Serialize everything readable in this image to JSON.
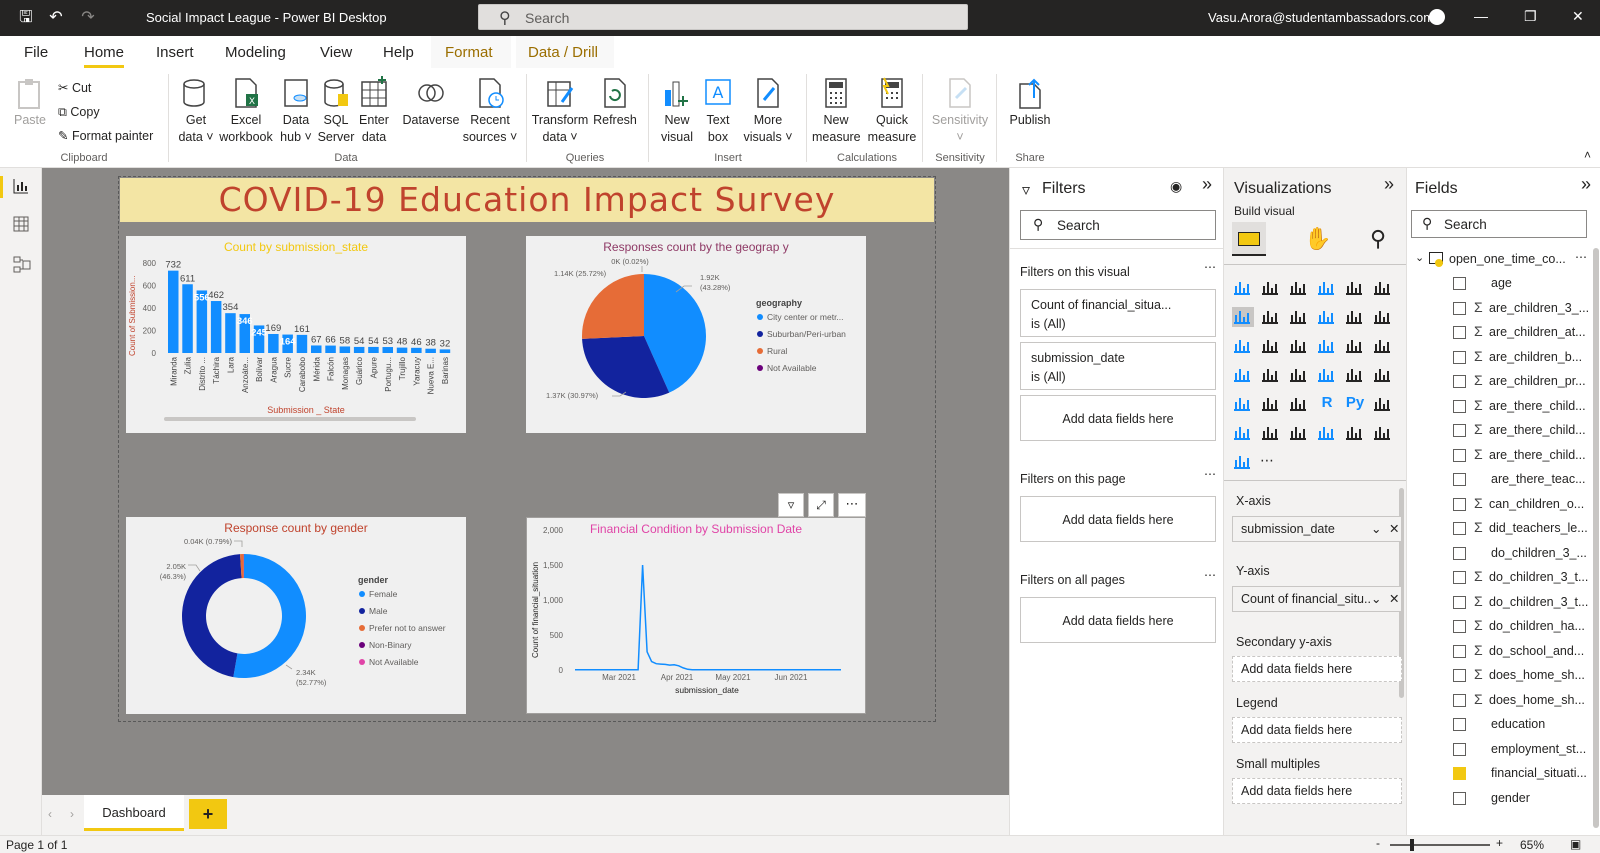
{
  "app": {
    "title": "Social Impact League - Power BI Desktop",
    "search_placeholder": "Search",
    "user": "Vasu.Arora@studentambassadors.com"
  },
  "menu": [
    "File",
    "Home",
    "Insert",
    "Modeling",
    "View",
    "Help",
    "Format",
    "Data / Drill"
  ],
  "ribbon": {
    "paste": "Paste",
    "cut": "Cut",
    "copy": "Copy",
    "format_painter": "Format painter",
    "clipboard": "Clipboard",
    "get_data": [
      "Get",
      "data"
    ],
    "excel": [
      "Excel",
      "workbook"
    ],
    "data_hub": [
      "Data",
      "hub"
    ],
    "sql": [
      "SQL",
      "Server"
    ],
    "enter_data": [
      "Enter",
      "data"
    ],
    "dataverse": "Dataverse",
    "recent": [
      "Recent",
      "sources"
    ],
    "data_group": "Data",
    "transform": [
      "Transform",
      "data"
    ],
    "refresh": "Refresh",
    "queries": "Queries",
    "new_visual": [
      "New",
      "visual"
    ],
    "text_box": [
      "Text",
      "box"
    ],
    "more_visuals": [
      "More",
      "visuals"
    ],
    "insert": "Insert",
    "new_measure": [
      "New",
      "measure"
    ],
    "quick_measure": [
      "Quick",
      "measure"
    ],
    "calculations": "Calculations",
    "sensitivity_btn": "Sensitivity",
    "sensitivity": "Sensitivity",
    "publish": "Publish",
    "share": "Share"
  },
  "report": {
    "title": "COVID-19 Education Impact Survey",
    "tab": "Dashboard",
    "page_status": "Page 1 of 1",
    "zoom": "65%"
  },
  "chart_data": [
    {
      "type": "bar",
      "title": "Count by submission_state",
      "xlabel": "Submission _ State",
      "ylabel": "Count of Submission...",
      "ylim": [
        0,
        800
      ],
      "yticks": [
        "800",
        "600",
        "400",
        "200",
        "0"
      ],
      "categories": [
        "Miranda",
        "Zulia",
        "Distrito ...",
        "Táchira",
        "Lara",
        "Anzoáte...",
        "Bolívar",
        "Aragua",
        "Sucre",
        "Carabobo",
        "Mérida",
        "Falcón",
        "Monagas",
        "Guárico",
        "Apure",
        "Portugu...",
        "Trujillo",
        "Yaracuy",
        "Nueva E...",
        "Barinas"
      ],
      "values": [
        732,
        611,
        556,
        462,
        354,
        346,
        245,
        169,
        164,
        161,
        67,
        66,
        58,
        54,
        54,
        53,
        48,
        46,
        38,
        32
      ],
      "labels": [
        "732",
        "611",
        "556",
        "462",
        "354",
        "346",
        "245",
        "169",
        "164",
        "161",
        "67",
        "66",
        "58",
        "54",
        "54",
        "53",
        "48",
        "46",
        "38",
        "32"
      ]
    },
    {
      "type": "pie",
      "title": "Responses count by the geograp y",
      "legend_title": "geography",
      "slices": [
        {
          "name": "City center or metr...",
          "value": 1920,
          "label": "1.92K\n(43.28%)",
          "color": "#118dff"
        },
        {
          "name": "Suburban/Peri-urban",
          "value": 1370,
          "label": "1.37K (30.97%)",
          "color": "#12239e"
        },
        {
          "name": "Rural",
          "value": 1140,
          "label": "1.14K (25.72%)",
          "color": "#e66c37"
        },
        {
          "name": "Not Available",
          "value": 1,
          "label": "0K (0.02%)",
          "color": "#6b007b"
        }
      ]
    },
    {
      "type": "pie",
      "title": "Response count by gender",
      "legend_title": "gender",
      "slices": [
        {
          "name": "Female",
          "value": 2340,
          "label": "2.34K\n(52.77%)",
          "color": "#118dff"
        },
        {
          "name": "Male",
          "value": 2050,
          "label": "2.05K\n(46.3%)",
          "color": "#12239e"
        },
        {
          "name": "Prefer not to answer",
          "value": 40,
          "label": "0.04K (0.79%)",
          "color": "#e66c37"
        },
        {
          "name": "Non-Binary",
          "value": 3,
          "label": "",
          "color": "#6b007b"
        },
        {
          "name": "Not Available",
          "value": 2,
          "label": "",
          "color": "#e044a7"
        }
      ]
    },
    {
      "type": "line",
      "title": "Financial Condition by Submission Date",
      "xlabel": "submission_date",
      "ylabel": "Count of financial_situation",
      "ylim": [
        0,
        2000
      ],
      "yticks": [
        "2,000",
        "1,500",
        "1,000",
        "500",
        "0"
      ],
      "xticks": [
        "Mar 2021",
        "Apr 2021",
        "May 2021",
        "Jun 2021"
      ],
      "series": [
        {
          "values": [
            5,
            5,
            5,
            5,
            5,
            5,
            5,
            5,
            5,
            5,
            5,
            5,
            5,
            5,
            5,
            1500,
            260,
            120,
            90,
            85,
            80,
            70,
            75,
            60,
            30,
            10,
            5,
            5,
            5,
            5,
            5,
            5,
            5,
            5,
            5,
            5,
            5,
            5,
            5,
            5,
            5,
            5,
            5,
            5,
            5,
            5,
            5,
            5,
            5,
            5,
            5,
            5,
            5,
            5,
            5,
            5,
            5,
            5,
            5,
            5
          ]
        }
      ]
    }
  ],
  "filters": {
    "title": "Filters",
    "search": "Search",
    "on_visual": "Filters on this visual",
    "cards": [
      {
        "name": "Count of financial_situa...",
        "state": "is (All)"
      },
      {
        "name": "submission_date",
        "state": "is (All)"
      }
    ],
    "add": "Add data fields here",
    "on_page": "Filters on this page",
    "on_all": "Filters on all pages"
  },
  "viz": {
    "title": "Visualizations",
    "build": "Build visual",
    "wells": [
      {
        "label": "X-axis",
        "value": "submission_date"
      },
      {
        "label": "Y-axis",
        "value": "Count of financial_situ..."
      },
      {
        "label": "Secondary y-axis",
        "value": "Add data fields here"
      },
      {
        "label": "Legend",
        "value": "Add data fields here"
      },
      {
        "label": "Small multiples",
        "value": "Add data fields here"
      }
    ]
  },
  "fields": {
    "title": "Fields",
    "search": "Search",
    "table": "open_one_time_co...",
    "items": [
      {
        "name": "age",
        "sigma": false,
        "checked": false
      },
      {
        "name": "are_children_3_...",
        "sigma": true,
        "checked": false
      },
      {
        "name": "are_children_at...",
        "sigma": true,
        "checked": false
      },
      {
        "name": "are_children_b...",
        "sigma": true,
        "checked": false
      },
      {
        "name": "are_children_pr...",
        "sigma": true,
        "checked": false
      },
      {
        "name": "are_there_child...",
        "sigma": true,
        "checked": false
      },
      {
        "name": "are_there_child...",
        "sigma": true,
        "checked": false
      },
      {
        "name": "are_there_child...",
        "sigma": true,
        "checked": false
      },
      {
        "name": "are_there_teac...",
        "sigma": false,
        "checked": false
      },
      {
        "name": "can_children_o...",
        "sigma": true,
        "checked": false
      },
      {
        "name": "did_teachers_le...",
        "sigma": true,
        "checked": false
      },
      {
        "name": "do_children_3_...",
        "sigma": false,
        "checked": false
      },
      {
        "name": "do_children_3_t...",
        "sigma": true,
        "checked": false
      },
      {
        "name": "do_children_3_t...",
        "sigma": true,
        "checked": false
      },
      {
        "name": "do_children_ha...",
        "sigma": true,
        "checked": false
      },
      {
        "name": "do_school_and...",
        "sigma": true,
        "checked": false
      },
      {
        "name": "does_home_sh...",
        "sigma": true,
        "checked": false
      },
      {
        "name": "does_home_sh...",
        "sigma": true,
        "checked": false
      },
      {
        "name": "education",
        "sigma": false,
        "checked": false
      },
      {
        "name": "employment_st...",
        "sigma": false,
        "checked": false
      },
      {
        "name": "financial_situati...",
        "sigma": false,
        "checked": true
      },
      {
        "name": "gender",
        "sigma": false,
        "checked": false
      }
    ]
  },
  "colors": {
    "accent": "#f2c811",
    "blue": "#118dff",
    "navy": "#12239e",
    "orange": "#e66c37",
    "purple": "#6b007b",
    "pink": "#e044a7"
  }
}
